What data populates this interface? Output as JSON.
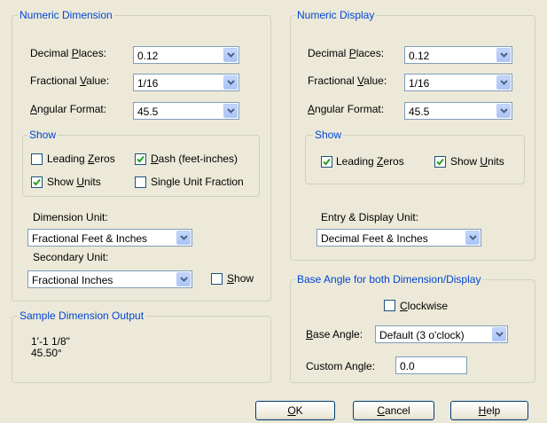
{
  "numeric_dimension": {
    "legend": "Numeric Dimension",
    "decimal_places_label": [
      "Decimal ",
      "P",
      "laces:"
    ],
    "decimal_places_value": "0.12",
    "fractional_value_label": [
      "Fractional ",
      "V",
      "alue:"
    ],
    "fractional_value_value": "1/16",
    "angular_format_label": [
      "",
      "A",
      "ngular Format:"
    ],
    "angular_format_value": "45.5",
    "show": {
      "legend": "Show",
      "leading_zeros": {
        "label": [
          "Leading ",
          "Z",
          "eros"
        ],
        "checked": false
      },
      "dash": {
        "label": [
          "",
          "D",
          "ash (feet-inches)"
        ],
        "checked": true
      },
      "show_units": {
        "label": [
          "Show ",
          "U",
          "nits"
        ],
        "checked": true
      },
      "single_unit_fraction": {
        "label": [
          "Single Unit Fraction",
          "",
          ""
        ],
        "checked": false
      }
    },
    "dimension_unit_label": "Dimension Unit:",
    "dimension_unit_value": "Fractional Feet & Inches",
    "secondary_unit_label": "Secondary Unit:",
    "secondary_unit_value": "Fractional Inches",
    "secondary_show": {
      "label": [
        "",
        "S",
        "how"
      ],
      "checked": false
    }
  },
  "sample_output": {
    "legend": "Sample Dimension Output",
    "line1": "1'-1 1/8\"",
    "line2": "45.50°"
  },
  "numeric_display": {
    "legend": "Numeric Display",
    "decimal_places_label": [
      "Decimal ",
      "P",
      "laces:"
    ],
    "decimal_places_value": "0.12",
    "fractional_value_label": [
      "Fractional ",
      "V",
      "alue:"
    ],
    "fractional_value_value": "1/16",
    "angular_format_label": [
      "",
      "A",
      "ngular Format:"
    ],
    "angular_format_value": "45.5",
    "show": {
      "legend": "Show",
      "leading_zeros": {
        "label": [
          "Leading ",
          "Z",
          "eros"
        ],
        "checked": true
      },
      "show_units": {
        "label": [
          "Show ",
          "U",
          "nits"
        ],
        "checked": true
      }
    },
    "entry_display_unit_label": "Entry & Display Unit:",
    "entry_display_unit_value": "Decimal Feet & Inches"
  },
  "base_angle": {
    "legend": "Base Angle for both Dimension/Display",
    "clockwise": {
      "label": [
        "",
        "C",
        "lockwise"
      ],
      "checked": false
    },
    "base_angle_label": [
      "",
      "B",
      "ase Angle:"
    ],
    "base_angle_value": "Default (3 o'clock)",
    "custom_angle_label": "Custom Angle:",
    "custom_angle_value": "0.0"
  },
  "buttons": {
    "ok": [
      "",
      "O",
      "K"
    ],
    "cancel": [
      "",
      "C",
      "ancel"
    ],
    "help": [
      "",
      "H",
      "elp"
    ]
  },
  "colors": {
    "accent": "#0046d5",
    "face": "#ece9d8",
    "check": "#21a121"
  }
}
